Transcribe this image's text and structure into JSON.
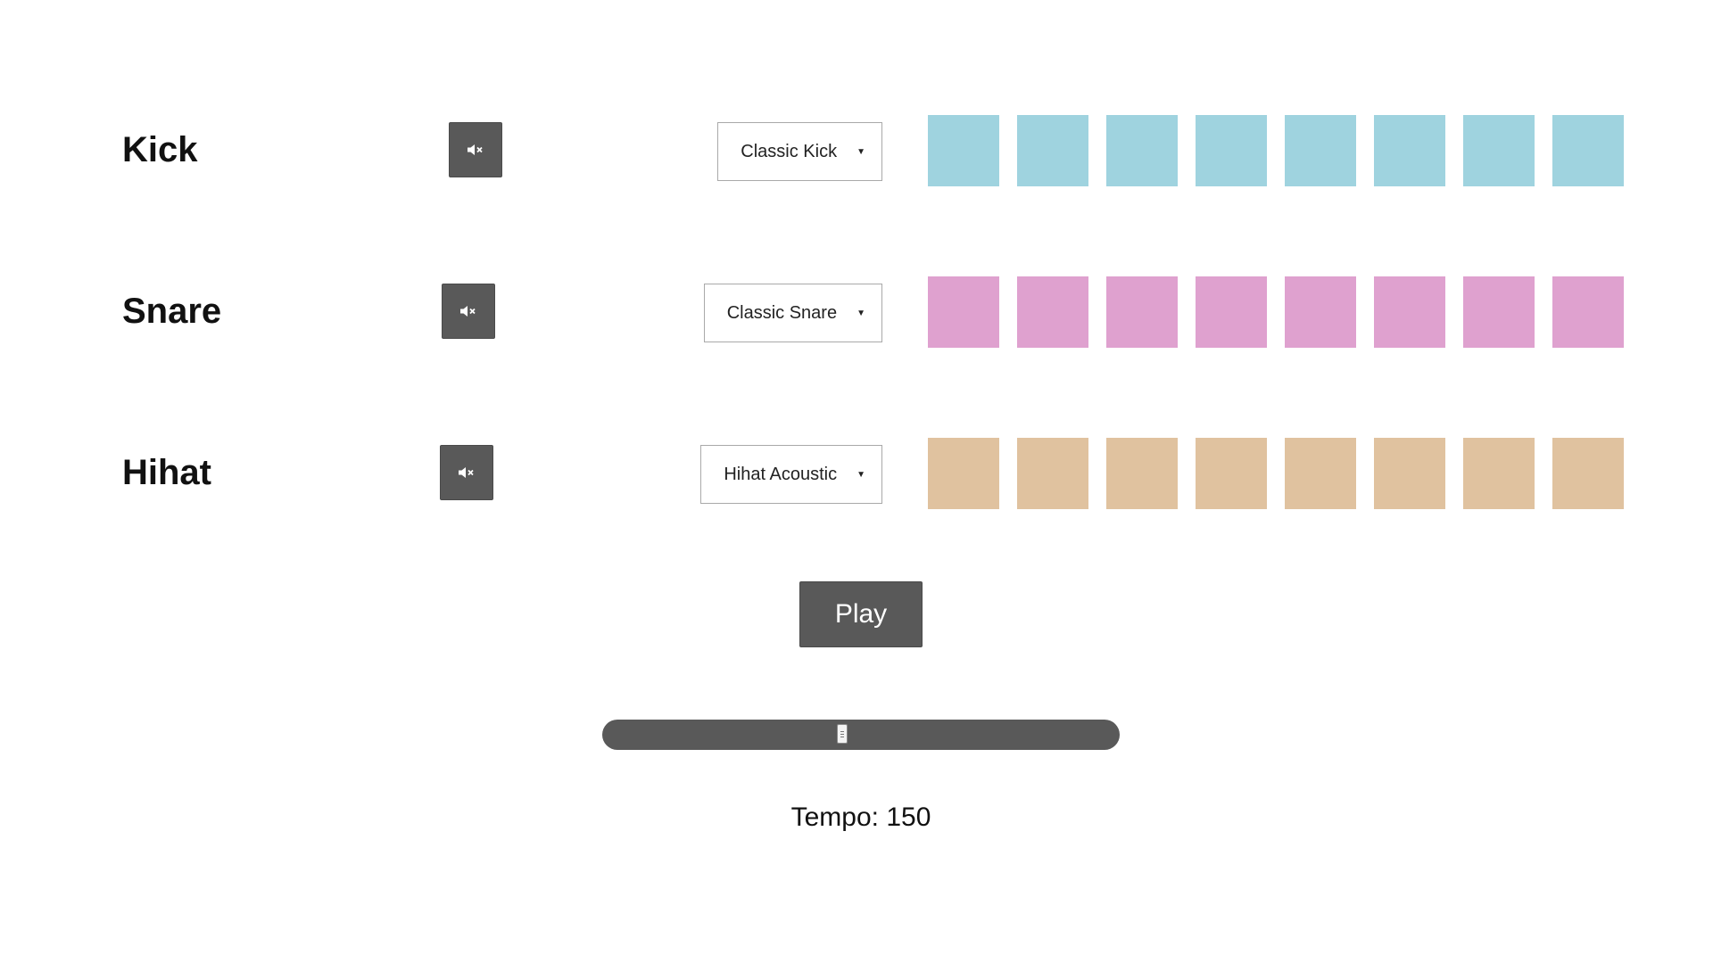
{
  "tracks": [
    {
      "label": "Kick",
      "mute_icon": "speaker-muted-icon",
      "sample": "Classic Kick",
      "step_color": "#9fd3df",
      "steps": 8
    },
    {
      "label": "Snare",
      "mute_icon": "speaker-muted-icon",
      "sample": "Classic Snare",
      "step_color": "#dfa1cf",
      "steps": 8
    },
    {
      "label": "Hihat",
      "mute_icon": "speaker-muted-icon",
      "sample": "Hihat Acoustic",
      "step_color": "#e0c29f",
      "steps": 8
    }
  ],
  "controls": {
    "play_label": "Play",
    "button_color": "#595959"
  },
  "tempo": {
    "prefix": "Tempo: ",
    "value": 150,
    "display": "Tempo: 150",
    "slider_fraction": 0.46
  }
}
